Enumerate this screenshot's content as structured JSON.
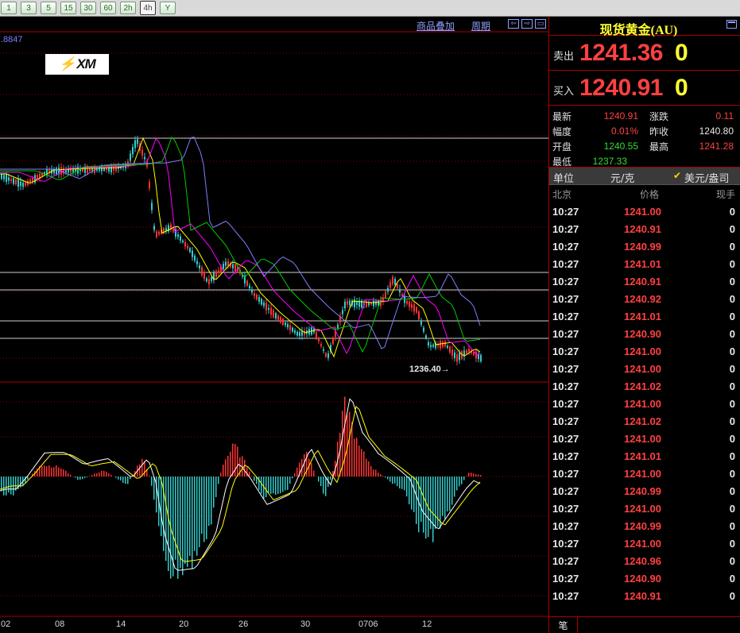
{
  "toolbar": {
    "buttons": [
      "1",
      "3",
      "5",
      "15",
      "30",
      "60",
      "2h",
      "4h",
      "Y"
    ],
    "active": "4h"
  },
  "chart": {
    "menu": {
      "overlay": "商品叠加",
      "period": "周期"
    },
    "ma_value": ".8847",
    "logo_text": "XM",
    "low_marker": "1236.40",
    "dates": [
      "02",
      "08",
      "14",
      "20",
      "26",
      "30",
      "0706",
      "12"
    ],
    "colors": {
      "up": "#ff3333",
      "down": "#33cccc",
      "ma_yellow": "#ffff00",
      "ma_magenta": "#ff00ff",
      "ma_green": "#00cc00",
      "ma_blue": "#7f7fff",
      "grid": "#8b0000"
    }
  },
  "quote": {
    "title": "现货黄金(AU)",
    "sell_label": "卖出",
    "sell_price": "1241.36",
    "sell_volume": "0",
    "buy_label": "买入",
    "buy_price": "1240.91",
    "buy_volume": "0",
    "stats": {
      "latest_label": "最新",
      "latest": "1240.91",
      "change_label": "涨跌",
      "change": "0.11",
      "range_label": "幅度",
      "range": "0.01%",
      "prev_close_label": "昨收",
      "prev_close": "1240.80",
      "open_label": "开盘",
      "open": "1240.55",
      "high_label": "最高",
      "high": "1241.28",
      "low_label": "最低",
      "low": "1237.33"
    },
    "unit": {
      "label": "单位",
      "value": "元/克",
      "option": "美元/盎司"
    },
    "trade_header": {
      "time": "北京",
      "price": "价格",
      "volume": "现手"
    },
    "trades": [
      {
        "time": "10:27",
        "price": "1241.00",
        "volume": "0"
      },
      {
        "time": "10:27",
        "price": "1240.91",
        "volume": "0"
      },
      {
        "time": "10:27",
        "price": "1240.99",
        "volume": "0"
      },
      {
        "time": "10:27",
        "price": "1241.01",
        "volume": "0"
      },
      {
        "time": "10:27",
        "price": "1240.91",
        "volume": "0"
      },
      {
        "time": "10:27",
        "price": "1240.92",
        "volume": "0"
      },
      {
        "time": "10:27",
        "price": "1241.01",
        "volume": "0"
      },
      {
        "time": "10:27",
        "price": "1240.90",
        "volume": "0"
      },
      {
        "time": "10:27",
        "price": "1241.00",
        "volume": "0"
      },
      {
        "time": "10:27",
        "price": "1241.00",
        "volume": "0"
      },
      {
        "time": "10:27",
        "price": "1241.02",
        "volume": "0"
      },
      {
        "time": "10:27",
        "price": "1241.00",
        "volume": "0"
      },
      {
        "time": "10:27",
        "price": "1241.02",
        "volume": "0"
      },
      {
        "time": "10:27",
        "price": "1241.00",
        "volume": "0"
      },
      {
        "time": "10:27",
        "price": "1241.01",
        "volume": "0"
      },
      {
        "time": "10:27",
        "price": "1241.00",
        "volume": "0"
      },
      {
        "time": "10:27",
        "price": "1240.99",
        "volume": "0"
      },
      {
        "time": "10:27",
        "price": "1241.00",
        "volume": "0"
      },
      {
        "time": "10:27",
        "price": "1240.99",
        "volume": "0"
      },
      {
        "time": "10:27",
        "price": "1241.00",
        "volume": "0"
      },
      {
        "time": "10:27",
        "price": "1240.96",
        "volume": "0"
      },
      {
        "time": "10:27",
        "price": "1240.90",
        "volume": "0"
      },
      {
        "time": "10:27",
        "price": "1240.91",
        "volume": "0"
      }
    ],
    "bottom_tab": "笔"
  }
}
